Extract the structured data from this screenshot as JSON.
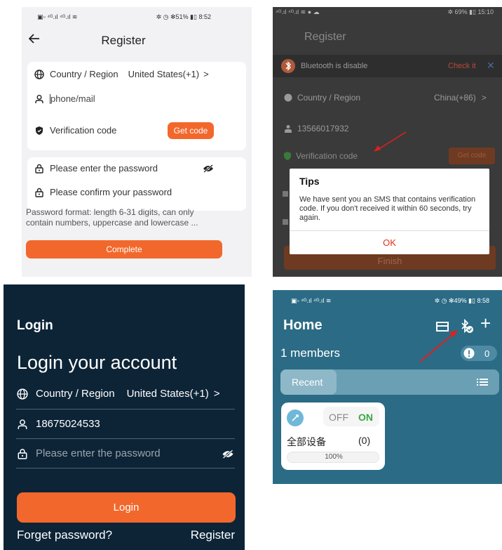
{
  "panel1": {
    "status_left": "▣▫ ⁴ᴳ.ıl ⁴ᴳ.ıl ≋",
    "status_right": "✲ ◷ ✻51% ▮▯ 8:52",
    "title": "Register",
    "country_label": "Country / Region",
    "country_value": "United States(+1)",
    "chevron": ">",
    "phone_placeholder": "phone/mail",
    "verification_label": "Verification code",
    "get_code": "Get code",
    "password_placeholder": "Please enter the password",
    "confirm_placeholder": "Please confirm your password",
    "hint": "Password format: length 6-31 digits, can only contain numbers, uppercase and lowercase ...",
    "complete": "Complete"
  },
  "panel2": {
    "status_left": "⁴ᴳ.ıl ⁴ᴳ.ıl ≋ ● ☁",
    "status_right": "✲ 69% ▮▯ 15:10",
    "title": "Register",
    "bluetooth_text": "Bluetooth is disable",
    "check_it": "Check it",
    "close": "✕",
    "country_label": "Country / Region",
    "country_value": "China(+86)",
    "chevron": ">",
    "phone": "13566017932",
    "verification_label": "Verification code",
    "get_code": "Get code",
    "dialog_title": "Tips",
    "dialog_message": "We have sent you an SMS that contains verification code. If you don't received it within 60 seconds, try again.",
    "dialog_ok": "OK",
    "finish": "Finish"
  },
  "panel3": {
    "header": "Login",
    "title": "Login your account",
    "country_label": "Country / Region",
    "country_value": "United States(+1)",
    "chevron": ">",
    "phone": "18675024533",
    "password_placeholder": "Please enter the password",
    "login": "Login",
    "forget": "Forget password?",
    "register": "Register"
  },
  "panel4": {
    "status_left": "▣▫ ⁴ᴳ.ıl ⁴ᴳ.ıl ≋",
    "status_right": "✲ ◷ ✻49% ▮▯ 8:58",
    "title": "Home",
    "plus": "+",
    "members": "1 members",
    "alert_count": "0",
    "recent": "Recent",
    "off": "OFF",
    "on": "ON",
    "device_name": "全部设备",
    "device_count": "(0)",
    "progress_text": "100%",
    "progress": 1.0
  },
  "colors": {
    "accent_orange": "#f2682c",
    "login_bg": "#0d2437",
    "home_bg": "#2b6b85",
    "on_green": "#3aa845",
    "annotation_red": "#e02020"
  }
}
